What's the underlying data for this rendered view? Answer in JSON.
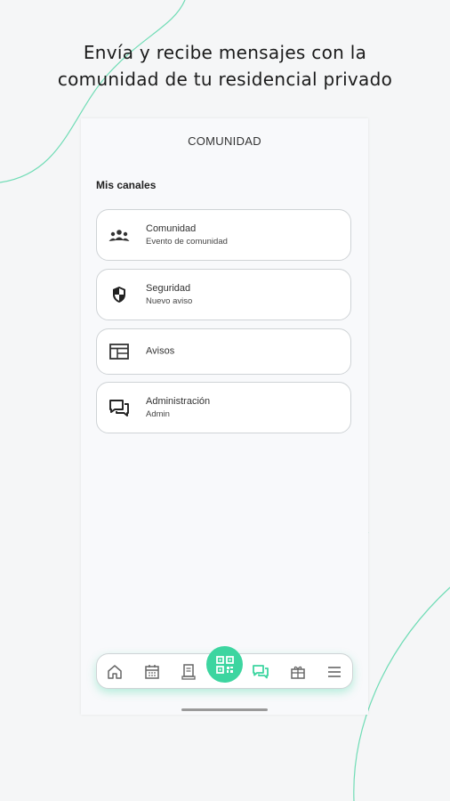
{
  "headline": {
    "line1": "Envía y recibe mensajes con la",
    "line2": "comunidad de tu residencial privado"
  },
  "screen": {
    "title": "COMUNIDAD",
    "section_label": "Mis canales"
  },
  "channels": [
    {
      "name": "Comunidad",
      "subtitle": "Evento de comunidad",
      "icon": "group-icon"
    },
    {
      "name": "Seguridad",
      "subtitle": "Nuevo aviso",
      "icon": "shield-icon"
    },
    {
      "name": "Avisos",
      "subtitle": "",
      "icon": "announcements-icon"
    },
    {
      "name": "Administración",
      "subtitle": "Admin",
      "icon": "chat-icon"
    }
  ],
  "bottom_nav": {
    "items": [
      "home-icon",
      "calendar-icon",
      "document-icon",
      "qr-code-icon",
      "chat-icon",
      "gift-icon",
      "menu-icon"
    ],
    "active": "chat-icon"
  },
  "colors": {
    "accent": "#3dd5a0",
    "background": "#f5f6f7",
    "card_border": "#cfd3d6"
  }
}
